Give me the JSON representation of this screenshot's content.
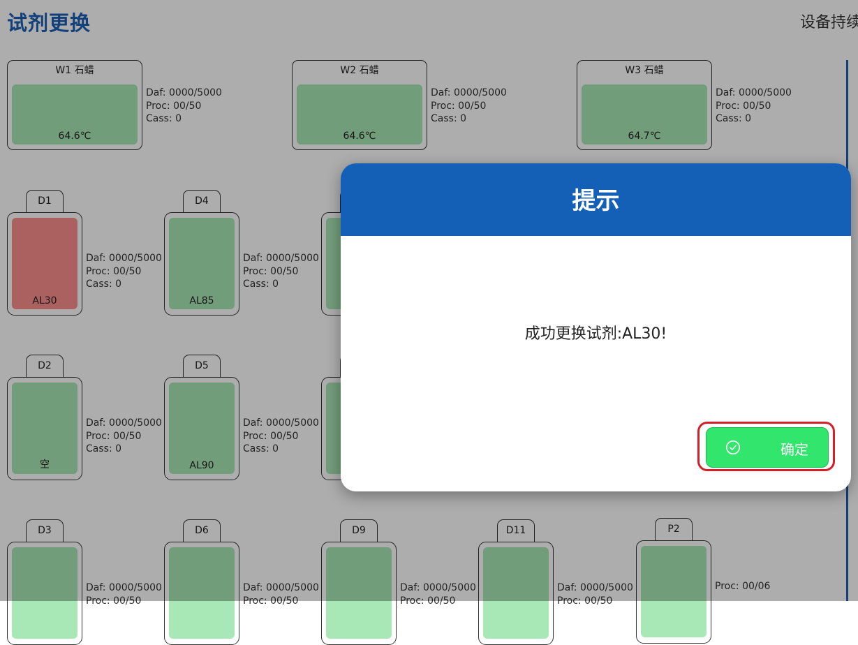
{
  "header": {
    "title": "试剂更换",
    "status_text": "设备持续"
  },
  "wax_units": [
    {
      "name": "W1 石蜡",
      "temp": "64.6℃",
      "daf": "Daf:  0000/5000",
      "proc": "Proc: 00/50",
      "cass": "Cass: 0"
    },
    {
      "name": "W2 石蜡",
      "temp": "64.6℃",
      "daf": "Daf:  0000/5000",
      "proc": "Proc: 00/50",
      "cass": "Cass: 0"
    },
    {
      "name": "W3 石蜡",
      "temp": "64.7℃",
      "daf": "Daf:  0000/5000",
      "proc": "Proc: 00/50",
      "cass": "Cass: 0"
    }
  ],
  "reagents": {
    "D1": {
      "label": "D1",
      "content": "AL30",
      "daf": "Daf:  0000/5000",
      "proc": "Proc: 00/50",
      "cass": "Cass: 0",
      "color": "#fd8f8c"
    },
    "D4": {
      "label": "D4",
      "content": "AL85",
      "daf": "Daf:  0000/5000",
      "proc": "Proc: 00/50",
      "cass": "Cass: 0"
    },
    "D2": {
      "label": "D2",
      "content": "空",
      "daf": "Daf:  0000/5000",
      "proc": "Proc: 00/50",
      "cass": "Cass: 0"
    },
    "D5": {
      "label": "D5",
      "content": "AL90",
      "daf": "Daf:  0000/5000",
      "proc": "Proc: 00/50",
      "cass": "Cass: 0"
    },
    "D3": {
      "label": "D3",
      "daf": "Daf:  0000/5000",
      "proc": "Proc: 00/50"
    },
    "D6": {
      "label": "D6",
      "daf": "Daf:  0000/5000",
      "proc": "Proc: 00/50"
    },
    "D9": {
      "label": "D9",
      "daf": "Daf:  0000/5000",
      "proc": "Proc: 00/50"
    },
    "D11": {
      "label": "D11",
      "daf": "Daf:  0000/5000",
      "proc": "Proc: 00/50"
    },
    "P2": {
      "label": "P2",
      "proc": "Proc: 00/06"
    }
  },
  "colors": {
    "fill_normal": "#a8e8b6",
    "fill_active": "#fd8f8c",
    "accent": "#1460b6",
    "confirm": "#32e56c"
  },
  "dialog": {
    "title": "提示",
    "message": "成功更换试剂:AL30!",
    "confirm_label": "确定",
    "confirm_icon": "check-circle-icon"
  }
}
